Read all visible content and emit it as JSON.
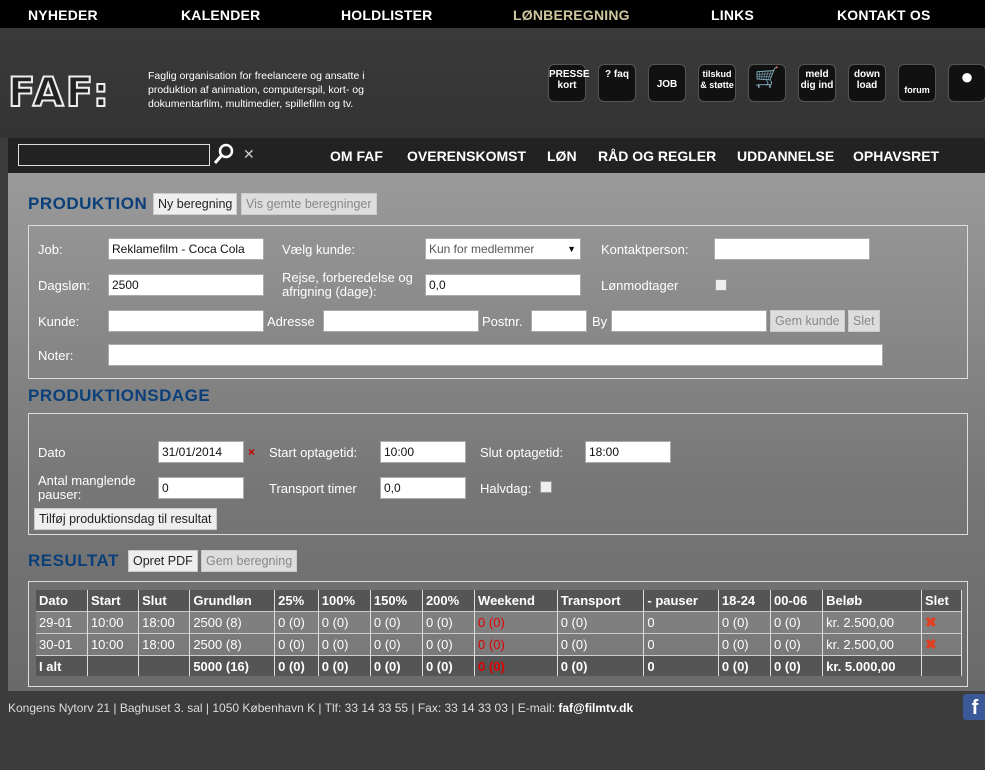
{
  "topnav": [
    "NYHEDER",
    "KALENDER",
    "HOLDLISTER",
    "LØNBEREGNING",
    "LINKS",
    "KONTAKT OS"
  ],
  "logo": "FAF:",
  "tagline": "Faglig organisation for freelancere og ansatte i produktion af animation, computerspil, kort- og dokumentarfilm, multimedier, spillefilm og tv.",
  "icons": [
    "PRESSE kort",
    "? faq",
    "JOB",
    "tilskud & støtte",
    "cart",
    "meld dig ind",
    "down load",
    "forum",
    "login"
  ],
  "subnav": [
    "OM FAF",
    "OVERENSKOMST",
    "LØN",
    "RÅD OG REGLER",
    "UDDANNELSE",
    "OPHAVSRET"
  ],
  "produktion": {
    "title": "PRODUKTION",
    "new_btn": "Ny beregning",
    "saved_btn": "Vis gemte beregninger",
    "job_label": "Job:",
    "job_value": "Reklamefilm - Coca Cola",
    "kunde_select_label": "Vælg kunde:",
    "kunde_select_value": "Kun for medlemmer",
    "kontakt_label": "Kontaktperson:",
    "dagslon_label": "Dagsløn:",
    "dagslon_value": "2500",
    "rejse_label": "Rejse, forberedelse og afrigning (dage):",
    "rejse_value": "0,0",
    "lonmodtager_label": "Lønmodtager",
    "kunde_label": "Kunde:",
    "adresse_label": "Adresse",
    "postnr_label": "Postnr.",
    "by_label": "By",
    "gem_kunde": "Gem kunde",
    "slet": "Slet",
    "noter_label": "Noter:"
  },
  "dage": {
    "title": "PRODUKTIONSDAGE",
    "dato_label": "Dato",
    "dato_value": "31/01/2014",
    "start_label": "Start optagetid:",
    "start_value": "10:00",
    "slut_label": "Slut optagetid:",
    "slut_value": "18:00",
    "pauser_label": "Antal manglende pauser:",
    "pauser_value": "0",
    "transport_label": "Transport timer",
    "transport_value": "0,0",
    "halvdag_label": "Halvdag:",
    "add_btn": "Tilføj produktionsdag til resultat"
  },
  "resultat": {
    "title": "RESULTAT",
    "pdf_btn": "Opret PDF",
    "gem_btn": "Gem beregning",
    "headers": [
      "Dato",
      "Start",
      "Slut",
      "Grundløn",
      "25%",
      "100%",
      "150%",
      "200%",
      "Weekend",
      "Transport",
      "- pauser",
      "18-24",
      "00-06",
      "Beløb",
      "Slet"
    ],
    "rows": [
      [
        "29-01",
        "10:00",
        "18:00",
        "2500 (8)",
        "0 (0)",
        "0 (0)",
        "0 (0)",
        "0 (0)",
        "0 (0)",
        "0 (0)",
        "0",
        "0 (0)",
        "0 (0)",
        "kr. 2.500,00"
      ],
      [
        "30-01",
        "10:00",
        "18:00",
        "2500 (8)",
        "0 (0)",
        "0 (0)",
        "0 (0)",
        "0 (0)",
        "0 (0)",
        "0 (0)",
        "0",
        "0 (0)",
        "0 (0)",
        "kr. 2.500,00"
      ]
    ],
    "total": [
      "I alt",
      "",
      "",
      "5000 (16)",
      "0 (0)",
      "0 (0)",
      "0 (0)",
      "0 (0)",
      "0 (0)",
      "0 (0)",
      "0",
      "0 (0)",
      "0 (0)",
      "kr. 5.000,00"
    ]
  },
  "footer": {
    "address": "Kongens Nytorv 21 | Baghuset 3. sal | 1050 København K | Tlf: 33 14 33 55 | Fax: 33 14 33 03 | E-mail: ",
    "email": "faf@filmtv.dk"
  },
  "facebook": "f"
}
